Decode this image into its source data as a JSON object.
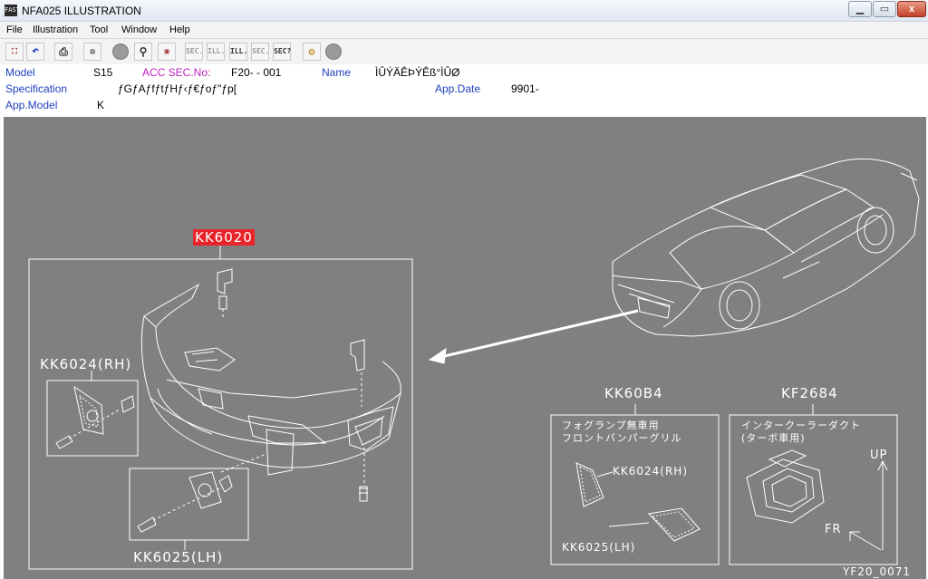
{
  "window": {
    "title": "NFA025 ILLUSTRATION",
    "icon_label": "FAST"
  },
  "menu": [
    "File",
    "Illustration",
    "Tool",
    "Window",
    "Help"
  ],
  "toolbar": {
    "buttons": [
      "exit-icon",
      "undo-icon",
      "print-icon",
      "sec-icon",
      "record-icon",
      "search-icon",
      "catalog-icon",
      "sec-prev-icon",
      "ill-prev-icon",
      "ill-next-icon",
      "sec-next-icon",
      "sec-query-icon",
      "help-icon",
      "record-icon"
    ],
    "sec_label": "SEC.",
    "ill_label": "ILL.",
    "secq_label": "SEC?"
  },
  "info": {
    "model_label": "Model",
    "model_value": "S15",
    "acc_label": "ACC SEC.No:",
    "acc_value": "F20-  - 001",
    "name_label": "Name",
    "name_value": "ÌÛÝÄÊÞÝÊß°ÌÛØ",
    "spec_label": "Specification",
    "spec_value": "ƒGƒAƒfƒtƒHƒ‹ƒ€ƒoƒ\"ƒp[",
    "appdate_label": "App.Date",
    "appdate_value": "9901-",
    "appmodel_label": "App.Model",
    "appmodel_value": "K"
  },
  "diagram": {
    "main_part": "KK6020",
    "part_rh": "KK6024(RH)",
    "part_lh": "KK6025(LH)",
    "box2_title": "KK60B4",
    "box2_note1": "フォグランプ無車用",
    "box2_note2": "フロントバンパーグリル",
    "box2_rh": "KK6024(RH)",
    "box2_lh": "KK6025(LH)",
    "box3_title": "KF2684",
    "box3_note1": "インタークーラーダクト",
    "box3_note2": "(ターボ車用)",
    "up_label": "UP",
    "fr_label": "FR",
    "figure_code": "YF20_0071"
  }
}
